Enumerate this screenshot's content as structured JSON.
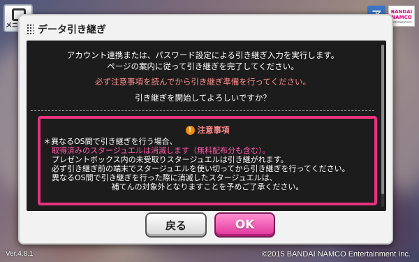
{
  "menu": {
    "label": "メニュー"
  },
  "logos": {
    "a": "ア",
    "brand_line1": "BANDAI",
    "brand_line2": "NAMCO",
    "brand_line3": "Entertainment"
  },
  "footer": {
    "version": "Ver.4.8.1",
    "copyright": "©2015 BANDAI NAMCO Entertainment Inc."
  },
  "dialog": {
    "title": "データ引き継ぎ",
    "intro_line1": "アカウント連携または、パスワード設定による引き継ぎ入力を実行します。",
    "intro_line2": "ページの案内に従って引き継ぎを完了してください。",
    "caution": "必ず注意事項を読んでから引き継ぎ準備を行ってください。",
    "confirm": "引き継ぎを開始してよろしいですか？",
    "notice": {
      "title": "注意事項",
      "line1": "＊異なるOS間で引き継ぎを行う場合、",
      "line2": "取得済みのスタージュエルは消滅します（無料配布分も含む）。",
      "line3": "プレゼントボックス内の未受取りスタージュエルは引き継がれます。",
      "line4": "必ず引き継ぎ前の端末でスタージュエルを使い切ってから引き継ぎを行ってください。",
      "line5": "異なるOS間で引き継ぎを行った際に消滅したスタージュエルは、",
      "line6": "補てんの対象外となりますことを予めご了承ください。"
    },
    "back_label": "戻る",
    "ok_label": "OK"
  },
  "colors": {
    "accent_pink": "#e6337d",
    "caution_red": "#ff8a8a",
    "ok_button": "#e0339a"
  }
}
